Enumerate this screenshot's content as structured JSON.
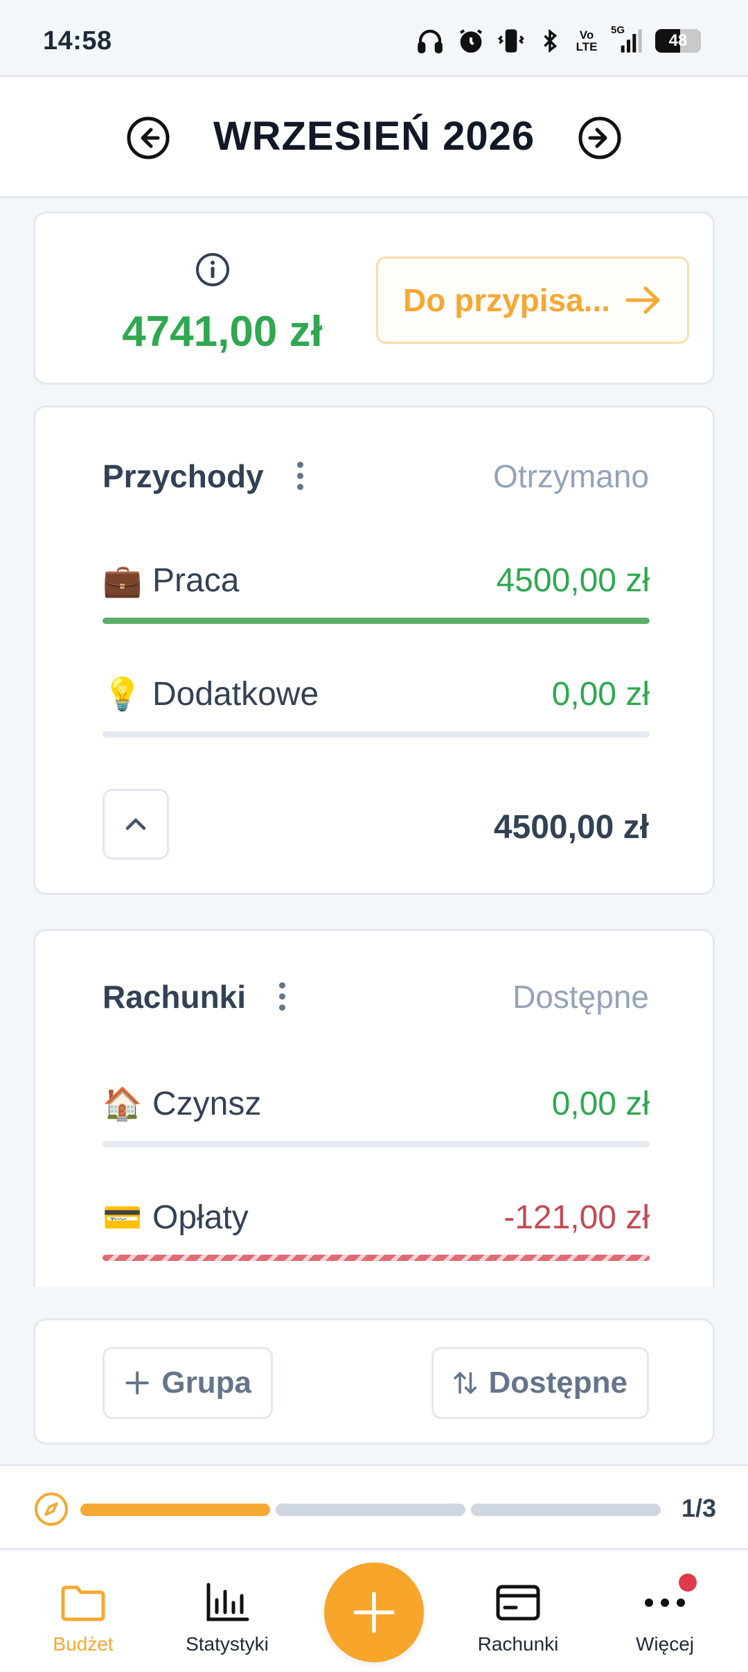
{
  "status_bar": {
    "time": "14:58",
    "network": "5G",
    "volte": "Vo LTE",
    "battery": "48"
  },
  "header": {
    "title": "WRZESIEŃ 2026"
  },
  "summary": {
    "amount": "4741,00 zł",
    "assign_label": "Do przypisa..."
  },
  "income_group": {
    "title": "Przychody",
    "column_label": "Otrzymano",
    "rows": [
      {
        "emoji": "💼",
        "label": "Praca",
        "value": "4500,00 zł",
        "progress": 1.0
      },
      {
        "emoji": "💡",
        "label": "Dodatkowe",
        "value": "0,00 zł",
        "progress": 0.0
      }
    ],
    "total": "4500,00 zł"
  },
  "bills_group": {
    "title": "Rachunki",
    "column_label": "Dostępne",
    "rows": [
      {
        "emoji": "🏠",
        "label": "Czynsz",
        "value": "0,00 zł",
        "progress": 0.0
      },
      {
        "emoji": "💳",
        "label": "Opłaty",
        "value": "-121,00 zł",
        "progress": 1.0,
        "overspent": true
      }
    ]
  },
  "actions": {
    "add_group_label": "Grupa",
    "sort_label": "Dostępne"
  },
  "onboarding": {
    "count": "1/3",
    "completed_steps": 1,
    "total_steps": 3
  },
  "bottom_nav": {
    "items": [
      {
        "label": "Budżet",
        "active": true
      },
      {
        "label": "Statystyki"
      },
      {
        "label": "Rachunki"
      },
      {
        "label": "Więcej",
        "has_badge": true
      }
    ]
  },
  "colors": {
    "accent": "#f5a833",
    "positive": "#2fa84f",
    "negative": "#c24a55",
    "badge": "#e03a4a"
  }
}
